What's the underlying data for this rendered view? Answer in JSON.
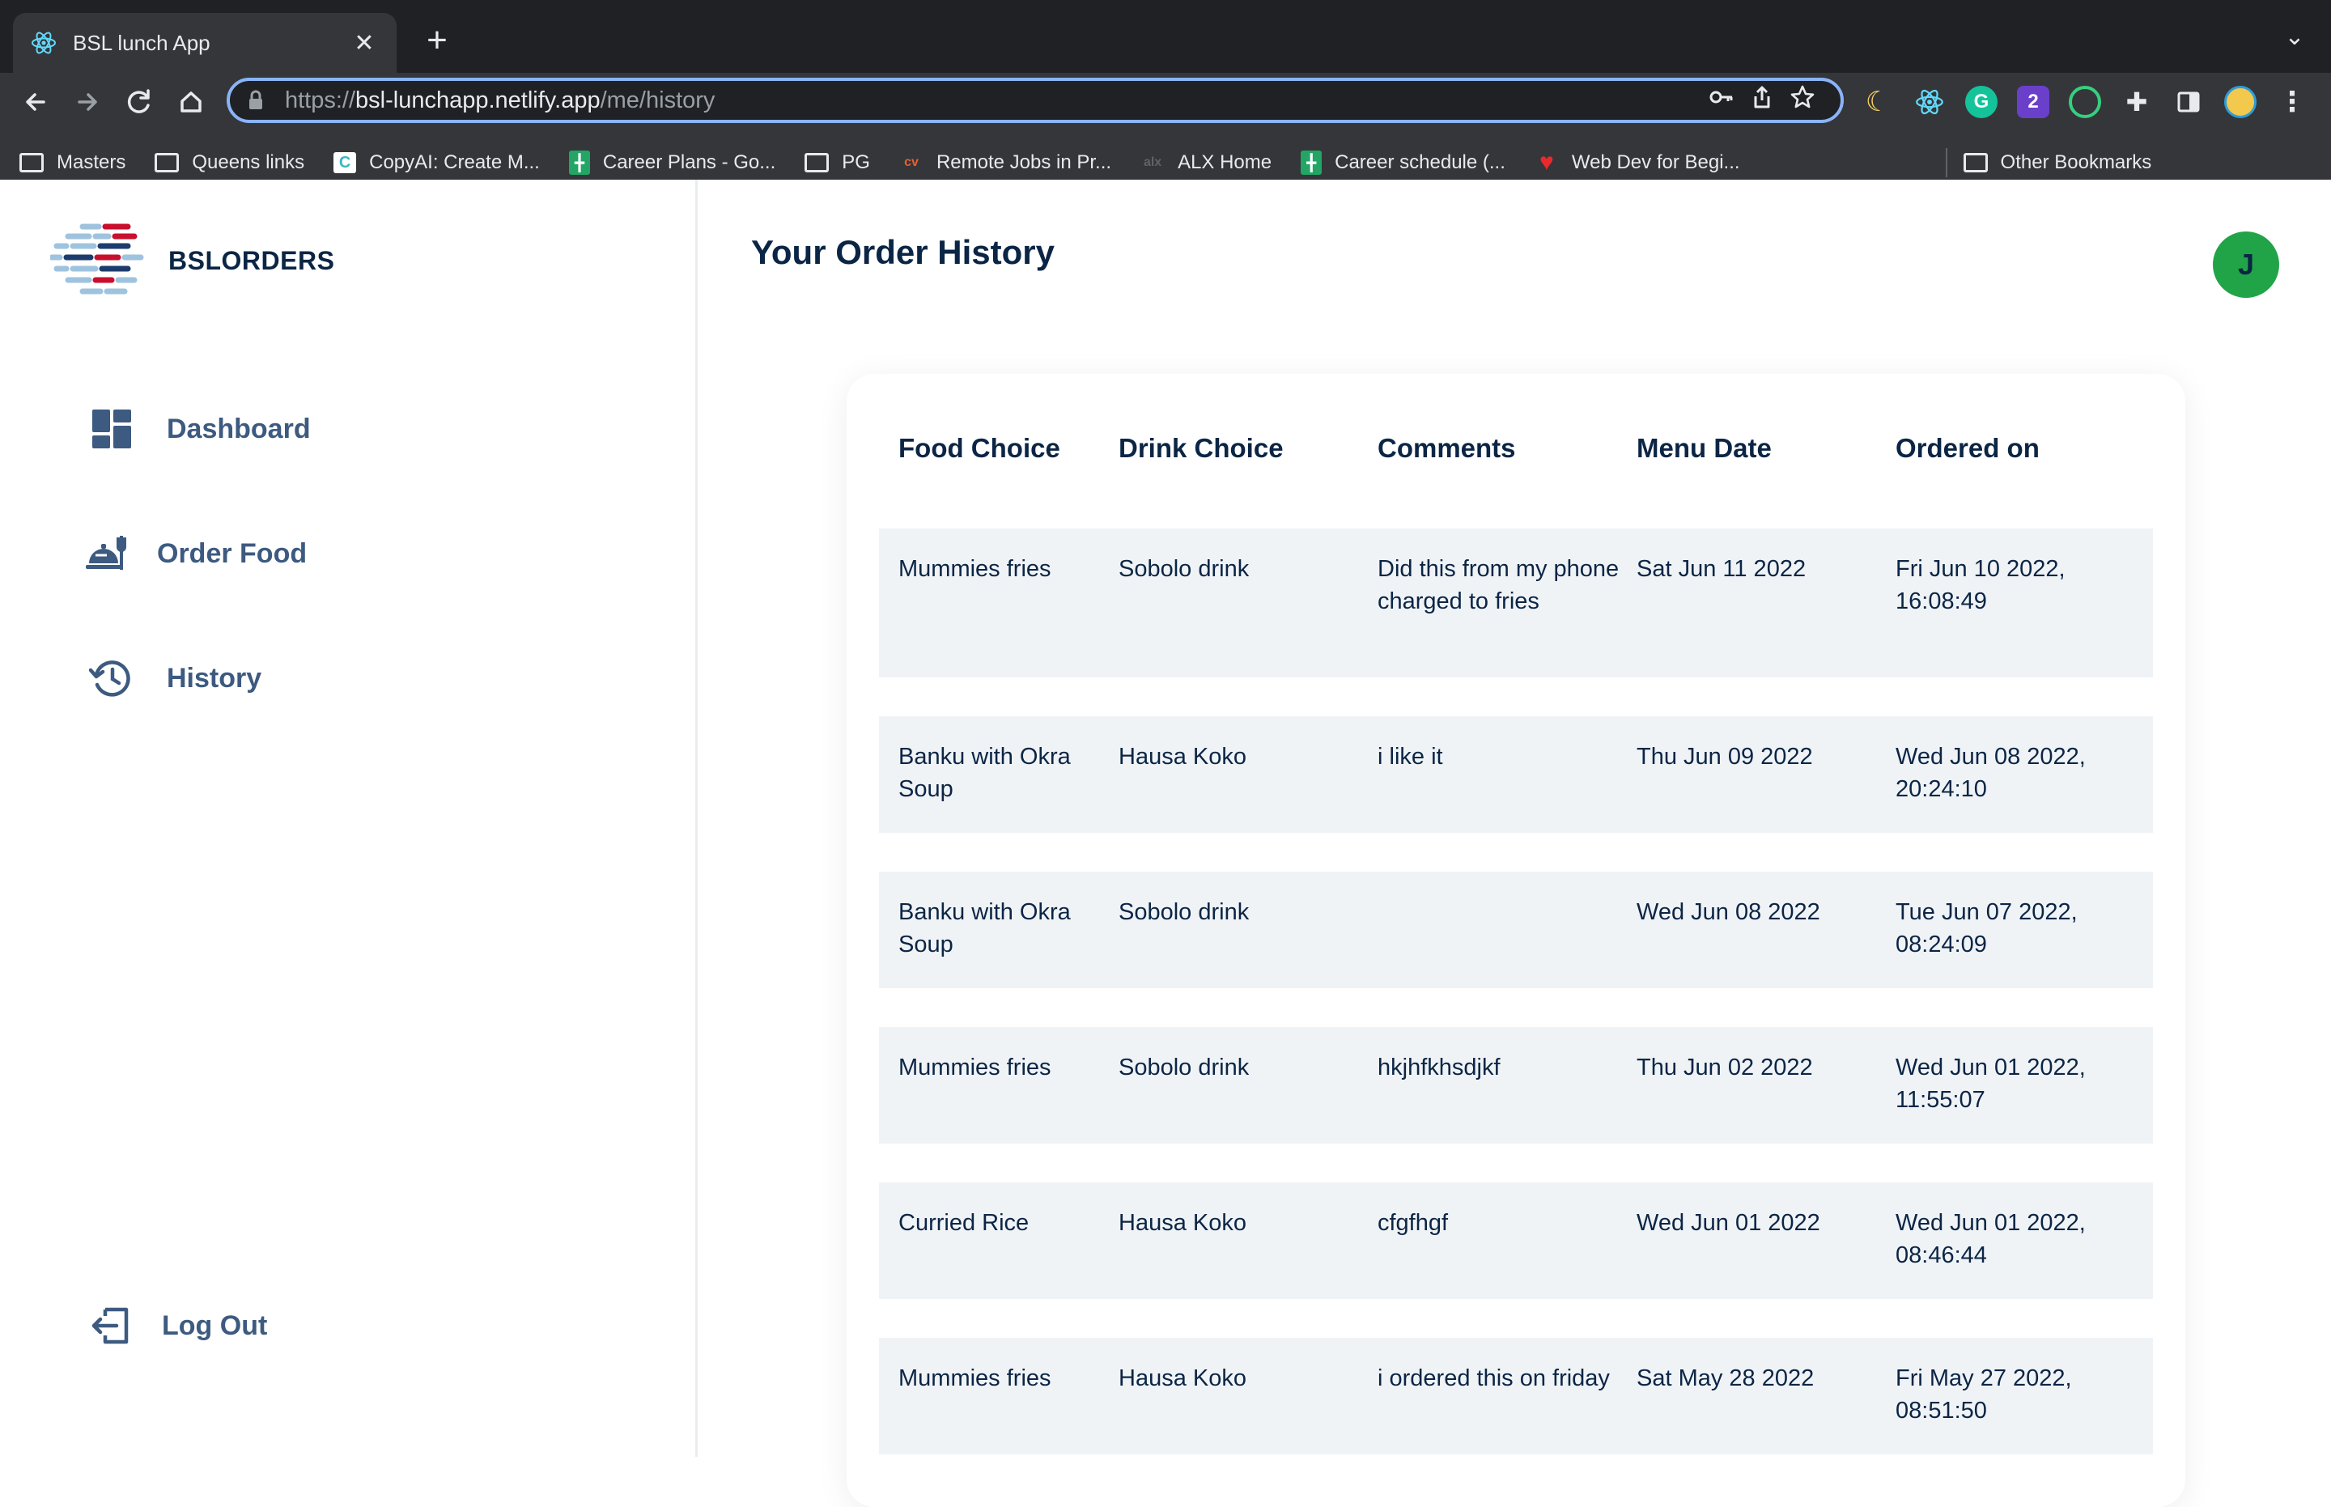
{
  "browser": {
    "tab_title": "BSL lunch App",
    "tab_close": "✕",
    "new_tab": "+",
    "tab_search": "⌄",
    "url_scheme": "https://",
    "url_host": "bsl-lunchapp.netlify.app",
    "url_path": "/me/history",
    "bookmarks": [
      {
        "label": "Masters",
        "icon": "folder-icon"
      },
      {
        "label": "Queens links",
        "icon": "folder-icon"
      },
      {
        "label": "CopyAI: Create M...",
        "icon": "copyai-icon"
      },
      {
        "label": "Career Plans - Go...",
        "icon": "sheets-icon"
      },
      {
        "label": "PG",
        "icon": "folder-icon"
      },
      {
        "label": "Remote Jobs in Pr...",
        "icon": "cv-icon"
      },
      {
        "label": "ALX Home",
        "icon": "alx-icon"
      },
      {
        "label": "Career schedule (...",
        "icon": "sheets-icon"
      },
      {
        "label": "Web Dev for Begi...",
        "icon": "heart-icon"
      }
    ],
    "other_bookmarks": "Other Bookmarks"
  },
  "sidebar": {
    "brand": "BSLORDERS",
    "nav": [
      {
        "label": "Dashboard",
        "icon": "dashboard-icon"
      },
      {
        "label": "Order Food",
        "icon": "order-food-icon"
      },
      {
        "label": "History",
        "icon": "history-icon"
      }
    ],
    "logout": "Log Out"
  },
  "main": {
    "title": "Your Order History",
    "avatar_initial": "J",
    "columns": [
      "Food Choice",
      "Drink Choice",
      "Comments",
      "Menu Date",
      "Ordered on"
    ],
    "rows": [
      {
        "food": "Mummies fries",
        "drink": "Sobolo drink",
        "comments": "Did this from my phone charged to fries",
        "menu_date": "Sat Jun 11 2022",
        "ordered_on": "Fri Jun 10 2022, 16:08:49"
      },
      {
        "food": "Banku with Okra Soup",
        "drink": "Hausa Koko",
        "comments": "i like it",
        "menu_date": "Thu Jun 09 2022",
        "ordered_on": "Wed Jun 08 2022, 20:24:10"
      },
      {
        "food": "Banku with Okra Soup",
        "drink": "Sobolo drink",
        "comments": "",
        "menu_date": "Wed Jun 08 2022",
        "ordered_on": "Tue Jun 07 2022, 08:24:09"
      },
      {
        "food": "Mummies fries",
        "drink": "Sobolo drink",
        "comments": "hkjhfkhsdjkf",
        "menu_date": "Thu Jun 02 2022",
        "ordered_on": "Wed Jun 01 2022, 11:55:07"
      },
      {
        "food": "Curried Rice",
        "drink": "Hausa Koko",
        "comments": "cfgfhgf",
        "menu_date": "Wed Jun 01 2022",
        "ordered_on": "Wed Jun 01 2022, 08:46:44"
      },
      {
        "food": "Mummies fries",
        "drink": "Hausa Koko",
        "comments": "i ordered this on friday",
        "menu_date": "Sat May 28 2022",
        "ordered_on": "Fri May 27 2022, 08:51:50"
      }
    ]
  },
  "colors": {
    "brand_navy": "#0b2545",
    "nav_text": "#3d5a80",
    "avatar_green": "#21a448",
    "row_bg": "#f0f3f6",
    "chrome_dark": "#202124",
    "chrome_toolbar": "#35363a",
    "omnibox_focus": "#8ab4f8"
  }
}
